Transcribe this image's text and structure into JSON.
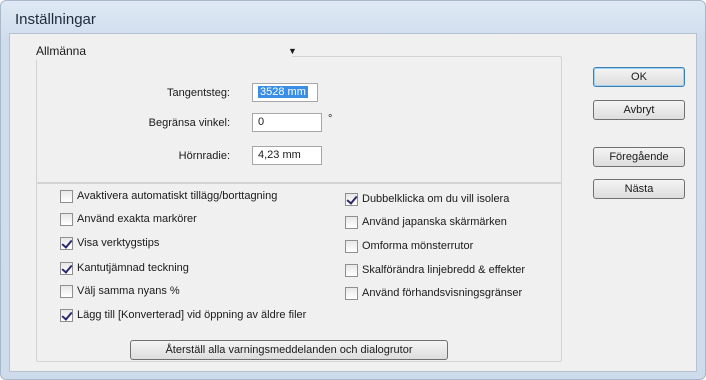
{
  "window": {
    "title": "Inställningar"
  },
  "panel": {
    "selected": "Allmänna"
  },
  "fields": {
    "keyboard_increment": {
      "label": "Tangentsteg:",
      "value": "3528 mm"
    },
    "constrain_angle": {
      "label": "Begränsa vinkel:",
      "value": "0",
      "unit": "°"
    },
    "corner_radius": {
      "label": "Hörnradie:",
      "value": "4,23 mm"
    }
  },
  "checkboxes_left": [
    {
      "label": "Avaktivera automatiskt tillägg/borttagning",
      "checked": false
    },
    {
      "label": "Använd exakta markörer",
      "checked": false
    },
    {
      "label": "Visa verktygstips",
      "checked": true
    },
    {
      "label": "Kantutjämnad teckning",
      "checked": true
    },
    {
      "label": "Välj samma nyans %",
      "checked": false
    },
    {
      "label": "Lägg till [Konverterad] vid öppning av äldre filer",
      "checked": true
    }
  ],
  "checkboxes_right": [
    {
      "label": "Dubbelklicka om du vill isolera",
      "checked": true
    },
    {
      "label": "Använd japanska skärmärken",
      "checked": false
    },
    {
      "label": "Omforma mönsterrutor",
      "checked": false
    },
    {
      "label": "Skalförändra linjebredd & effekter",
      "checked": false
    },
    {
      "label": "Använd förhandsvisningsgränser",
      "checked": false
    }
  ],
  "buttons": {
    "ok": "OK",
    "cancel": "Avbryt",
    "previous": "Föregående",
    "next": "Nästa",
    "reset": "Återställ alla varningsmeddelanden och dialogrutor"
  }
}
